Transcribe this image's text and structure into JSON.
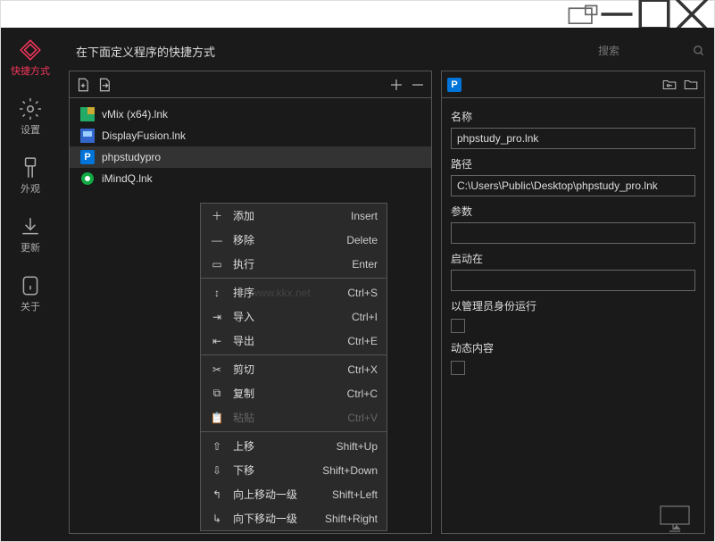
{
  "sidebar": {
    "items": [
      {
        "label": "快捷方式"
      },
      {
        "label": "设置"
      },
      {
        "label": "外观"
      },
      {
        "label": "更新"
      },
      {
        "label": "关于"
      }
    ]
  },
  "heading": "在下面定义程序的快捷方式",
  "search": {
    "placeholder": "搜索"
  },
  "list": {
    "items": [
      {
        "label": "vMix (x64).lnk"
      },
      {
        "label": "DisplayFusion.lnk"
      },
      {
        "label": "phpstudypro"
      },
      {
        "label": "iMindQ.lnk"
      }
    ]
  },
  "menu": [
    {
      "icon": "＋",
      "label": "添加",
      "shortcut": "Insert"
    },
    {
      "icon": "—",
      "label": "移除",
      "shortcut": "Delete"
    },
    {
      "icon": "▭",
      "label": "执行",
      "shortcut": "Enter"
    },
    {
      "sep": true
    },
    {
      "icon": "↕",
      "label": "排序",
      "shortcut": "Ctrl+S"
    },
    {
      "icon": "⇥",
      "label": "导入",
      "shortcut": "Ctrl+I"
    },
    {
      "icon": "⇤",
      "label": "导出",
      "shortcut": "Ctrl+E"
    },
    {
      "sep": true
    },
    {
      "icon": "✂",
      "label": "剪切",
      "shortcut": "Ctrl+X"
    },
    {
      "icon": "⧉",
      "label": "复制",
      "shortcut": "Ctrl+C"
    },
    {
      "icon": "📋",
      "label": "粘贴",
      "shortcut": "Ctrl+V",
      "disabled": true
    },
    {
      "sep": true
    },
    {
      "icon": "⇧",
      "label": "上移",
      "shortcut": "Shift+Up"
    },
    {
      "icon": "⇩",
      "label": "下移",
      "shortcut": "Shift+Down"
    },
    {
      "icon": "↰",
      "label": "向上移动一级",
      "shortcut": "Shift+Left"
    },
    {
      "icon": "↳",
      "label": "向下移动一级",
      "shortcut": "Shift+Right"
    }
  ],
  "form": {
    "name_label": "名称",
    "name_value": "phpstudy_pro.lnk",
    "path_label": "路径",
    "path_value": "C:\\Users\\Public\\Desktop\\phpstudy_pro.lnk",
    "args_label": "参数",
    "args_value": "",
    "startin_label": "启动在",
    "startin_value": "",
    "admin_label": "以管理员身份运行",
    "dynamic_label": "动态内容"
  },
  "watermark": "www.kkx.net"
}
